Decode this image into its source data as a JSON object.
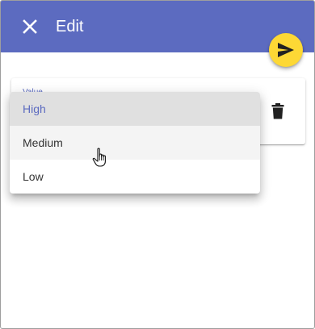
{
  "header": {
    "title": "Edit",
    "close_icon": "close-icon",
    "background": "#5c6bc0"
  },
  "fab": {
    "icon": "send-icon",
    "color": "#fdd835"
  },
  "card": {
    "field_label": "Value",
    "delete_icon": "delete-icon"
  },
  "menu": {
    "items": [
      {
        "label": "High",
        "selected": true
      },
      {
        "label": "Medium",
        "hovered": true
      },
      {
        "label": "Low"
      }
    ]
  },
  "colors": {
    "accent": "#5c6bc0",
    "fab": "#fdd835",
    "selected_bg": "#e0e0e0"
  }
}
